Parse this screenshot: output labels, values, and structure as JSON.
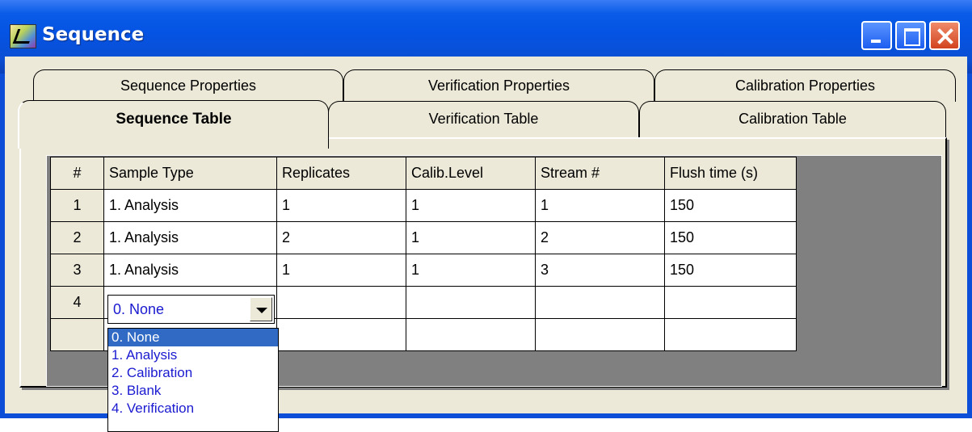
{
  "window": {
    "title": "Sequence"
  },
  "tabs_back": [
    {
      "label": "Sequence Properties"
    },
    {
      "label": "Verification Properties"
    },
    {
      "label": "Calibration Properties"
    }
  ],
  "tabs_front": [
    {
      "label": "Sequence Table",
      "active": true
    },
    {
      "label": "Verification Table"
    },
    {
      "label": "Calibration Table"
    }
  ],
  "table": {
    "headers": [
      "#",
      "Sample Type",
      "Replicates",
      "Calib.Level",
      "Stream #",
      "Flush time (s)"
    ],
    "rows": [
      [
        "1",
        "1. Analysis",
        "1",
        "1",
        "1",
        "150"
      ],
      [
        "2",
        "1. Analysis",
        "2",
        "1",
        "2",
        "150"
      ],
      [
        "3",
        "1. Analysis",
        "1",
        "1",
        "3",
        "150"
      ],
      [
        "4",
        "",
        "",
        "",
        "",
        ""
      ],
      [
        "",
        "",
        "",
        "",
        "",
        ""
      ]
    ]
  },
  "dropdown": {
    "selected": "0. None",
    "options": [
      "0. None",
      "1. Analysis",
      "2. Calibration",
      "3. Blank",
      "4. Verification"
    ]
  }
}
